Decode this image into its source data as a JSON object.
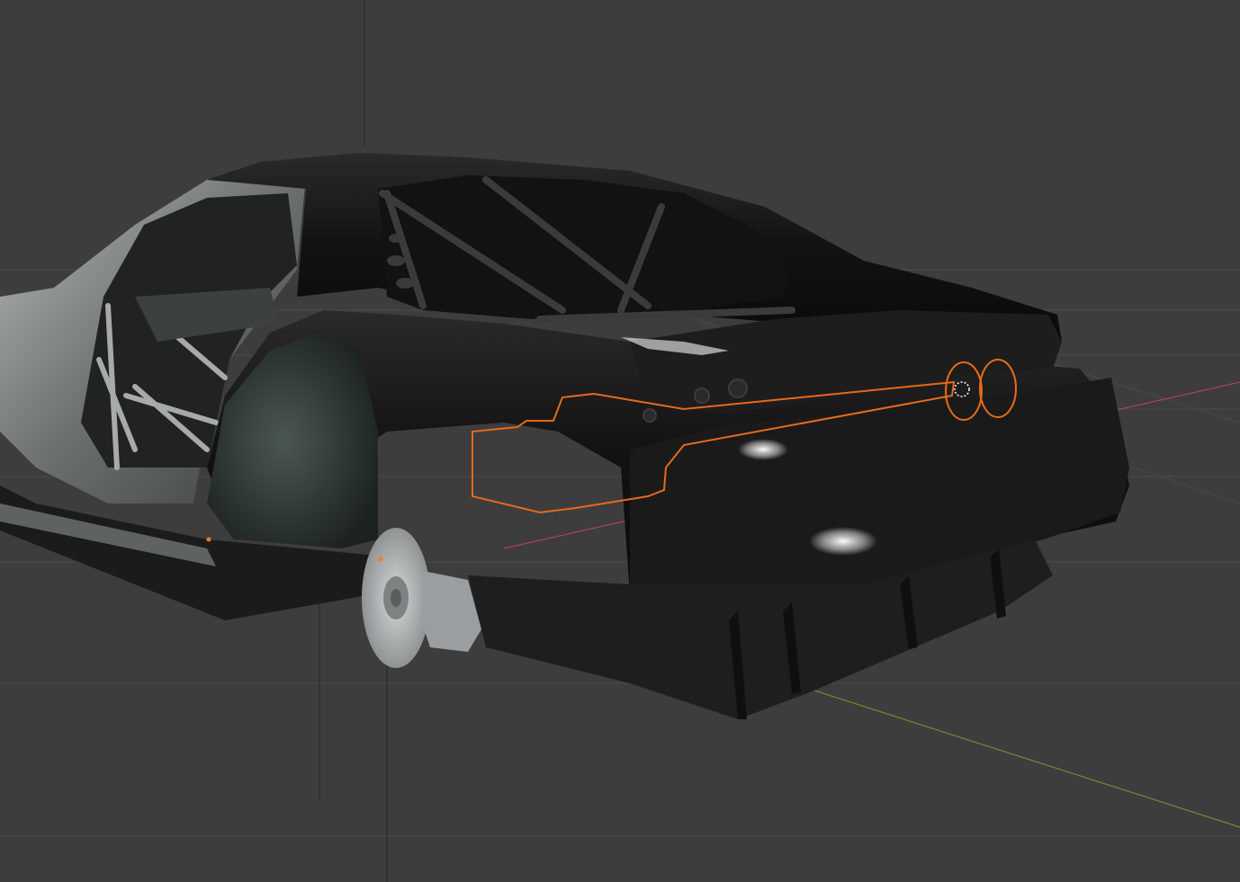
{
  "viewport": {
    "background_color": "#3d3d3d",
    "grid_color": "#4a4a4a",
    "x_axis_color": "#a8474f",
    "y_axis_color": "#6b8e2f",
    "selection_outline_color": "#e66a1a",
    "origin_marker_color": "#ff7a1a",
    "selection_label": "",
    "icons": {
      "selected_object": "exhaust-outline-icon",
      "object_origin": "origin-dot-icon"
    }
  },
  "model": {
    "body_color": "#151515",
    "carbon_color": "#1e1e1e",
    "chassis_color": "#8a8f8c",
    "brake_disc_color": "#b9bcbd"
  }
}
